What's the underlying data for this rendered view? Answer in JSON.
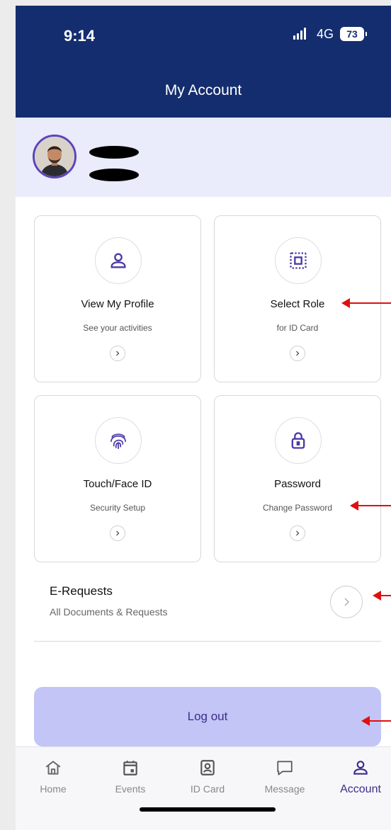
{
  "status_bar": {
    "time": "9:14",
    "network": "4G",
    "battery": "73"
  },
  "header": {
    "title": "My Account"
  },
  "cards": [
    {
      "title": "View My Profile",
      "subtitle": "See your activities",
      "icon": "person-icon"
    },
    {
      "title": "Select Role",
      "subtitle": "for ID Card",
      "icon": "id-frame-icon"
    },
    {
      "title": "Touch/Face ID",
      "subtitle": "Security Setup",
      "icon": "fingerprint-icon"
    },
    {
      "title": "Password",
      "subtitle": "Change Password",
      "icon": "lock-icon"
    }
  ],
  "e_requests": {
    "title": "E-Requests",
    "subtitle": "All Documents & Requests"
  },
  "logout_label": "Log out",
  "tabs": [
    {
      "label": "Home",
      "icon": "home-icon"
    },
    {
      "label": "Events",
      "icon": "calendar-icon"
    },
    {
      "label": "ID Card",
      "icon": "id-card-icon"
    },
    {
      "label": "Message",
      "icon": "message-icon"
    },
    {
      "label": "Account",
      "icon": "account-icon",
      "active": true
    }
  ],
  "colors": {
    "header": "#142d6e",
    "accent": "#5a45b8",
    "logout_bg": "#c2c5f5",
    "annotation_arrow": "#e01010"
  }
}
